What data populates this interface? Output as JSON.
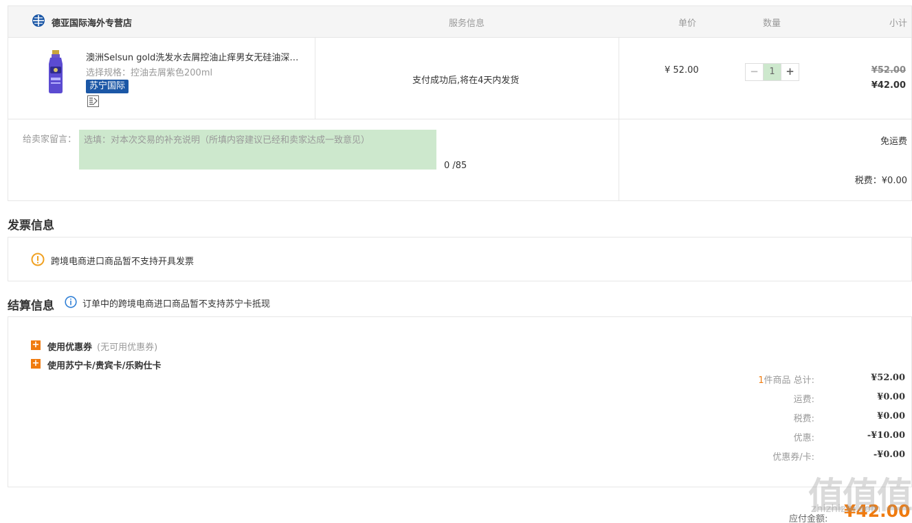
{
  "store": {
    "name": "德亚国际海外专营店",
    "icon": "globe-icon"
  },
  "columns": {
    "service": "服务信息",
    "unit_price": "单价",
    "quantity": "数量",
    "subtotal": "小计"
  },
  "product": {
    "name": "澳洲Selsun gold洗发水去屑控油止痒男女无硅油深…",
    "spec": "选择规格：控油去屑紫色200ml",
    "badge": "苏宁国际",
    "service_text": "支付成功后,将在4天内发货",
    "unit_price": "¥ 52.00",
    "quantity": "1",
    "minus": "−",
    "plus": "+",
    "original_subtotal": "¥52.00",
    "subtotal": "¥42.00"
  },
  "message": {
    "label": "给卖家留言：",
    "placeholder": "选填：对本次交易的补充说明（所填内容建议已经和卖家达成一致意见）",
    "count": "0 /85"
  },
  "shipping_note": "免运费",
  "tax_note": "税费：¥0.00",
  "invoice": {
    "title": "发票信息",
    "text": "跨境电商进口商品暂不支持开具发票",
    "icon": "warning-icon"
  },
  "settlement": {
    "title": "结算信息",
    "note": "订单中的跨境电商进口商品暂不支持苏宁卡抵现",
    "coupon_label": "使用优惠券",
    "coupon_note": "(无可用优惠券)",
    "card_label": "使用苏宁卡/贵宾卡/乐购仕卡",
    "summary": {
      "count": "1",
      "total_label": "件商品 总计:",
      "total": "¥52.00",
      "shipping_label": "运费:",
      "shipping": "¥0.00",
      "tax_label": "税费:",
      "tax": "¥0.00",
      "discount_label": "优惠:",
      "discount": "-¥10.00",
      "card_label": "优惠券/卡:",
      "card": "-¥0.00"
    }
  },
  "payable": {
    "label": "应付金额:",
    "value": "¥42.00"
  },
  "watermark": {
    "text": "值值值",
    "sub": "zhizhizhi.com"
  }
}
